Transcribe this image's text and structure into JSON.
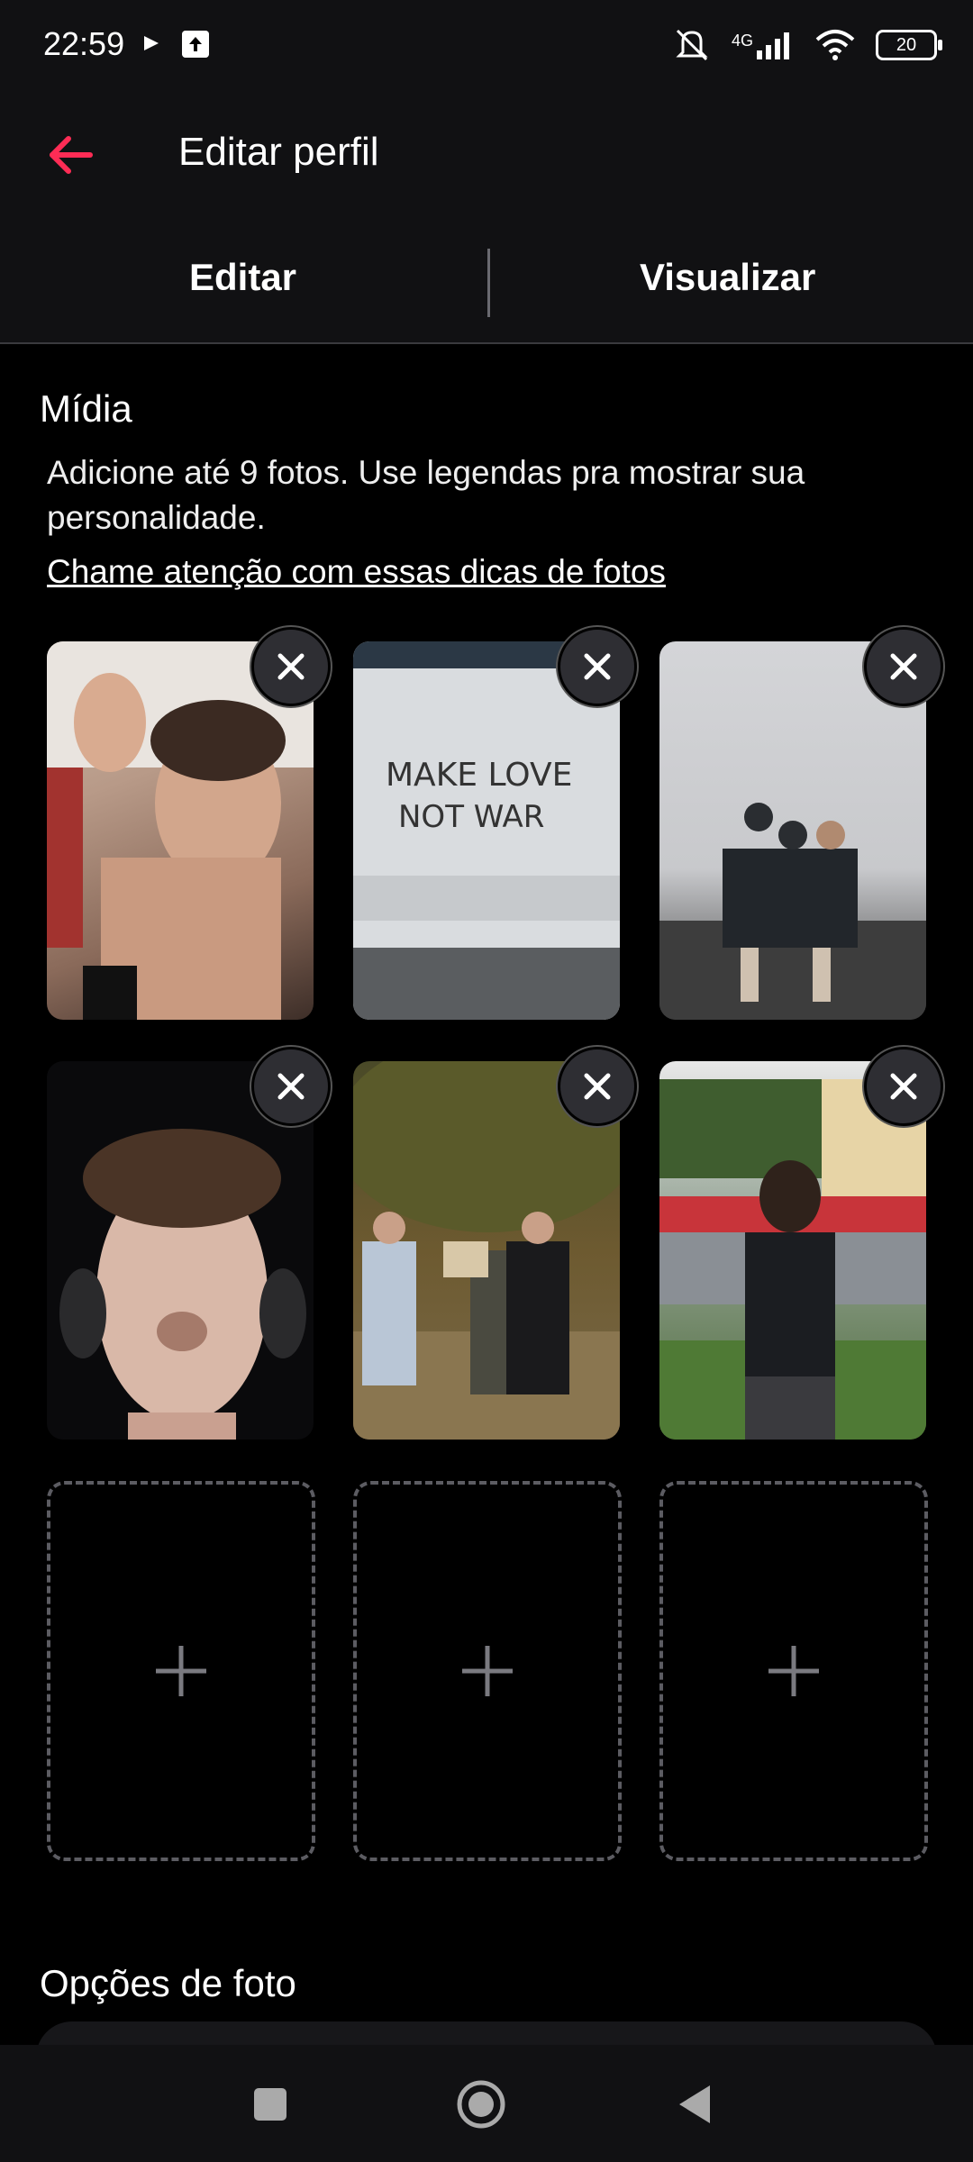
{
  "status": {
    "time": "22:59",
    "network": "4G",
    "battery": "20",
    "icons": [
      "play-icon",
      "upload-icon",
      "mute-icon",
      "signal-icon",
      "wifi-icon",
      "battery-icon"
    ]
  },
  "header": {
    "title": "Editar perfil",
    "back_icon": "back-arrow-icon",
    "accent": "#fe2c55"
  },
  "tabs": [
    {
      "label": "Editar",
      "selected": true
    },
    {
      "label": "Visualizar",
      "selected": false
    }
  ],
  "media": {
    "title": "Mídia",
    "description": "Adicione até 9 fotos. Use legendas pra mostrar sua personalidade.",
    "tips_link": "Chame atenção com essas dicas de fotos",
    "photos": [
      {
        "alt": "selfie-flex"
      },
      {
        "alt": "make-love-not-war-sign"
      },
      {
        "alt": "group-on-mountain"
      },
      {
        "alt": "headphones-selfie"
      },
      {
        "alt": "night-group-statue"
      },
      {
        "alt": "street-back-view"
      }
    ],
    "empty_slots": 3,
    "max_photos": 9
  },
  "photo_options": {
    "title": "Opções de foto"
  },
  "navbar": {
    "icons": [
      "recents-square-icon",
      "home-circle-icon",
      "back-triangle-icon"
    ]
  }
}
